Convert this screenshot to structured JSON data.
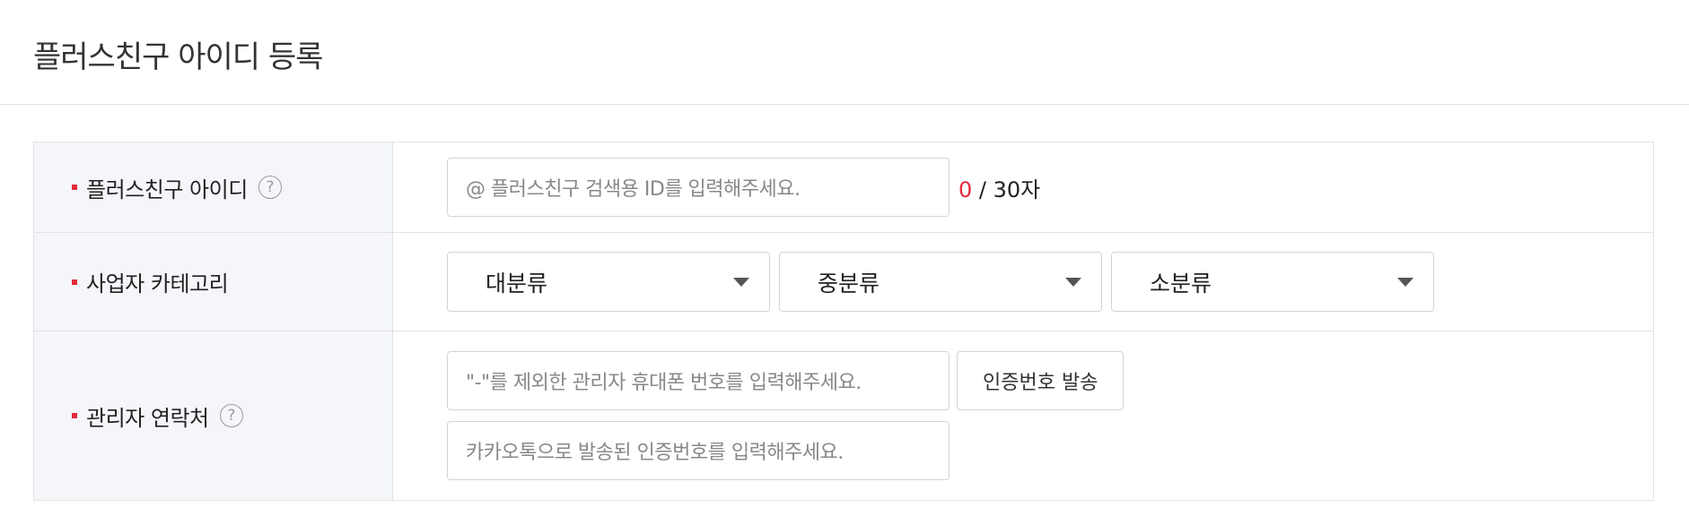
{
  "page": {
    "title": "플러스친구 아이디 등록"
  },
  "form": {
    "plusfriend_id": {
      "label": "플러스친구 아이디",
      "help_symbol": "?",
      "placeholder": "@ 플러스친구 검색용 ID를 입력해주세요.",
      "count_current": "0",
      "count_max": " / 30자"
    },
    "category": {
      "label": "사업자 카테고리",
      "selects": [
        {
          "selected": "대분류"
        },
        {
          "selected": "중분류"
        },
        {
          "selected": "소분류"
        }
      ]
    },
    "contact": {
      "label": "관리자 연락처",
      "help_symbol": "?",
      "phone_placeholder": "\"-\"를 제외한 관리자 휴대폰 번호를 입력해주세요.",
      "send_button_label": "인증번호 발송",
      "code_placeholder": "카카오톡으로 발송된 인증번호를 입력해주세요."
    }
  },
  "colors": {
    "required_mark": "#e5293c",
    "header_bg": "#f4f6fa",
    "border": "#e3e3e3"
  },
  "icons": {
    "help": "question-circle-icon",
    "dropdown": "chevron-down-icon"
  }
}
